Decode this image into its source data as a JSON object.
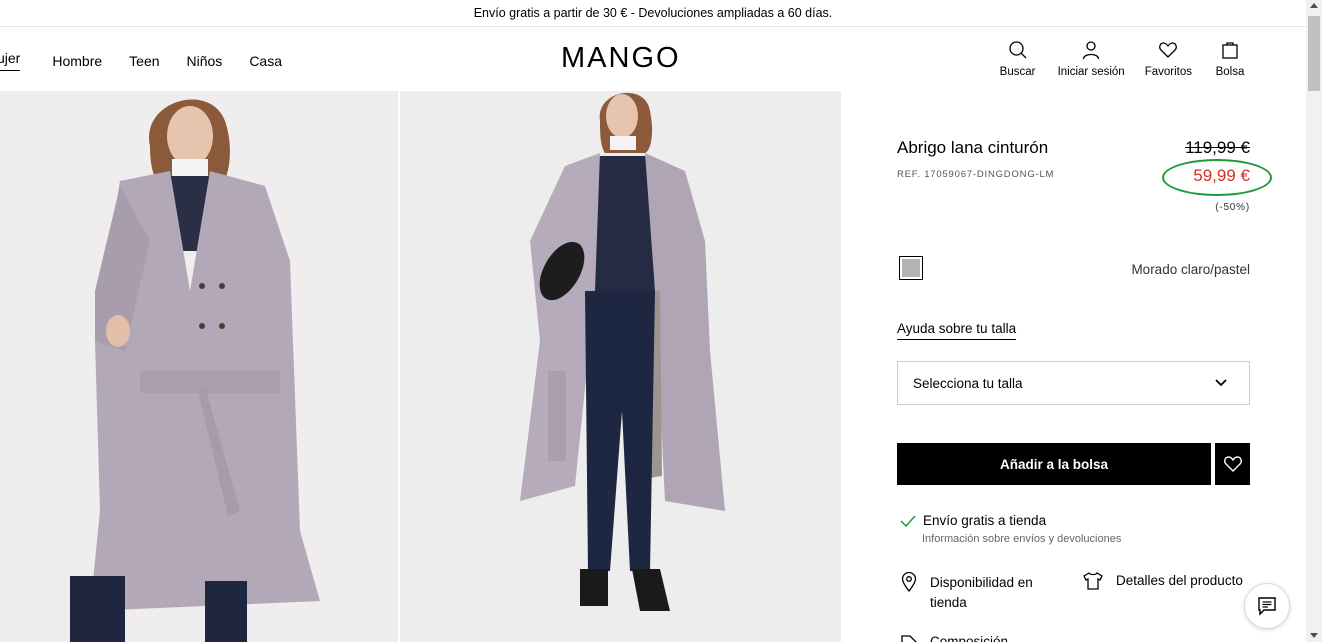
{
  "promo": {
    "text": "Envío gratis a partir de 30 € - Devoluciones ampliadas a 60 días."
  },
  "nav": {
    "active": "ujer",
    "items": [
      {
        "label": "Hombre"
      },
      {
        "label": "Teen"
      },
      {
        "label": "Niños"
      },
      {
        "label": "Casa"
      }
    ]
  },
  "brand": {
    "logo_text": "MANGO"
  },
  "header_actions": {
    "search": "Buscar",
    "login": "Iniciar sesión",
    "favorites": "Favoritos",
    "bag": "Bolsa"
  },
  "product": {
    "title": "Abrigo lana cinturón",
    "ref": "REF. 17059067-DINGDONG-LM",
    "price_old": "119,99 €",
    "price_new": "59,99 €",
    "discount": "(-50%)",
    "color_name": "Morado claro/pastel",
    "swatch_color": "#b7b2b8",
    "price_color": "#d0302a",
    "highlight_color": "#1e9a3a"
  },
  "size": {
    "help": "Ayuda sobre tu talla",
    "select_placeholder": "Selecciona tu talla"
  },
  "actions": {
    "add_to_bag": "Añadir a la bolsa"
  },
  "shipping": {
    "title": "Envío gratis a tienda",
    "info": "Información sobre envíos y devoluciones"
  },
  "links": {
    "availability": "Disponibilidad en tienda",
    "details": "Detalles del producto",
    "composition": "Composición"
  }
}
